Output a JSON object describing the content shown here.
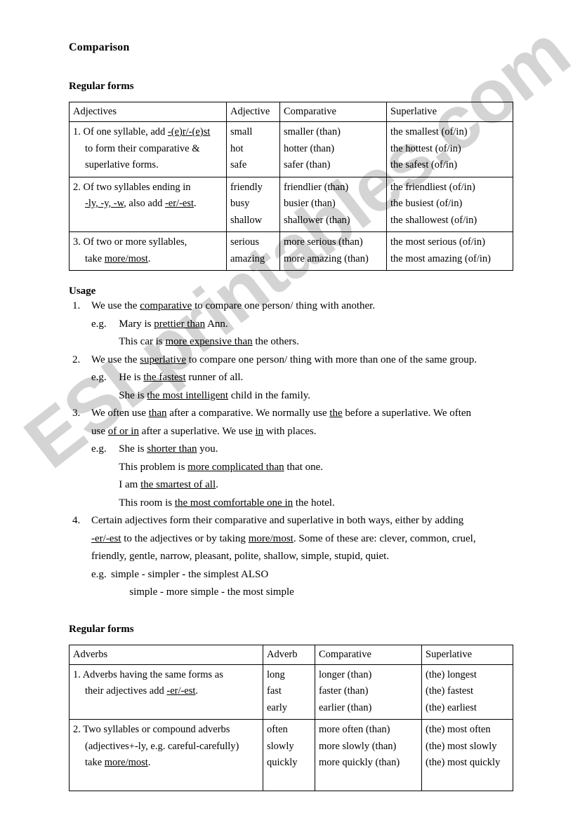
{
  "document": {
    "title": "Comparison",
    "watermark": "ESLprintables.com",
    "watermark_color": "#d4d4d4"
  },
  "adjectives_section": {
    "heading": "Regular forms",
    "table": {
      "headers": [
        "Adjectives",
        "Adjective",
        "Comparative",
        "Superlative"
      ],
      "rows": [
        {
          "rule": [
            "1. Of one syllable, add ",
            "-(e)r/-(e)st",
            " to form their comparative &",
            " superlative forms."
          ],
          "rule_lines": [
            {
              "text_before": "1. Of one syllable, add ",
              "underlined": "-(e)r/-(e)st",
              "text_after": "",
              "indent": false
            },
            {
              "text_before": "to form their comparative &",
              "underlined": "",
              "text_after": "",
              "indent": true
            },
            {
              "text_before": "superlative forms.",
              "underlined": "",
              "text_after": "",
              "indent": true
            }
          ],
          "adjective": [
            "small",
            "hot",
            "safe"
          ],
          "comparative": [
            "smaller (than)",
            "hotter (than)",
            "safer (than)"
          ],
          "superlative": [
            "the smallest (of/in)",
            "the hottest (of/in)",
            "the safest (of/in)"
          ]
        },
        {
          "rule_lines": [
            {
              "text_before": "2. Of two syllables ending in",
              "underlined": "",
              "text_after": "",
              "indent": false
            },
            {
              "text_before": "",
              "underlined": "-ly, -y, -w",
              "text_after": ", also add ",
              "underlined2": "-er/-est",
              "text_after2": ".",
              "indent": true
            }
          ],
          "adjective": [
            "friendly",
            "busy",
            "shallow"
          ],
          "comparative": [
            "friendlier (than)",
            "busier (than)",
            "shallower (than)"
          ],
          "superlative": [
            "the friendliest (of/in)",
            "the busiest (of/in)",
            "the shallowest (of/in)"
          ]
        },
        {
          "rule_lines": [
            {
              "text_before": "3. Of two or more syllables,",
              "underlined": "",
              "text_after": "",
              "indent": false
            },
            {
              "text_before": "take ",
              "underlined": "more/most",
              "text_after": ".",
              "indent": true
            }
          ],
          "adjective": [
            "serious",
            "amazing"
          ],
          "comparative": [
            "more serious (than)",
            "more amazing (than)"
          ],
          "superlative": [
            "the most serious (of/in)",
            "the most amazing (of/in)"
          ]
        }
      ]
    }
  },
  "usage_section": {
    "heading": "Usage",
    "items": [
      {
        "number": "1.",
        "lines": [
          {
            "parts": [
              {
                "t": "We use the ",
                "u": false
              },
              {
                "t": "comparative",
                "u": true
              },
              {
                "t": " to compare one person/ thing with another.",
                "u": false
              }
            ]
          }
        ],
        "examples": {
          "label": "e.g.",
          "lines": [
            {
              "parts": [
                {
                  "t": "Mary is ",
                  "u": false
                },
                {
                  "t": "prettier than",
                  "u": true
                },
                {
                  "t": " Ann.",
                  "u": false
                }
              ]
            },
            {
              "parts": [
                {
                  "t": "This car is ",
                  "u": false
                },
                {
                  "t": "more expensive than",
                  "u": true
                },
                {
                  "t": " the others.",
                  "u": false
                }
              ]
            }
          ]
        }
      },
      {
        "number": "2.",
        "lines": [
          {
            "parts": [
              {
                "t": "We use the ",
                "u": false
              },
              {
                "t": "superlative",
                "u": true
              },
              {
                "t": " to compare one person/ thing with more than one of the same group.",
                "u": false
              }
            ]
          }
        ],
        "examples": {
          "label": "e.g.",
          "lines": [
            {
              "parts": [
                {
                  "t": "He is ",
                  "u": false
                },
                {
                  "t": "the fastest",
                  "u": true
                },
                {
                  "t": " runner of all.",
                  "u": false
                }
              ]
            },
            {
              "parts": [
                {
                  "t": "She is ",
                  "u": false
                },
                {
                  "t": "the most intelligent",
                  "u": true
                },
                {
                  "t": " child in the family.",
                  "u": false
                }
              ]
            }
          ]
        }
      },
      {
        "number": "3.",
        "lines": [
          {
            "parts": [
              {
                "t": "We often use ",
                "u": false
              },
              {
                "t": "than",
                "u": true
              },
              {
                "t": " after a comparative. We normally use ",
                "u": false
              },
              {
                "t": "the",
                "u": true
              },
              {
                "t": " before a superlative. We often",
                "u": false
              }
            ]
          },
          {
            "parts": [
              {
                "t": "use ",
                "u": false
              },
              {
                "t": "of or in",
                "u": true
              },
              {
                "t": " after a superlative. We use ",
                "u": false
              },
              {
                "t": "in",
                "u": true
              },
              {
                "t": " with places.",
                "u": false
              }
            ]
          }
        ],
        "examples": {
          "label": "e.g.",
          "lines": [
            {
              "parts": [
                {
                  "t": "She is ",
                  "u": false
                },
                {
                  "t": "shorter than",
                  "u": true
                },
                {
                  "t": " you.",
                  "u": false
                }
              ]
            },
            {
              "parts": [
                {
                  "t": "This problem is ",
                  "u": false
                },
                {
                  "t": "more complicated than",
                  "u": true
                },
                {
                  "t": " that one.",
                  "u": false
                }
              ]
            },
            {
              "parts": [
                {
                  "t": "I am ",
                  "u": false
                },
                {
                  "t": "the smartest of all",
                  "u": true
                },
                {
                  "t": ".",
                  "u": false
                }
              ]
            },
            {
              "parts": [
                {
                  "t": "This room is ",
                  "u": false
                },
                {
                  "t": "the most comfortable one in",
                  "u": true
                },
                {
                  "t": " the hotel.",
                  "u": false
                }
              ]
            }
          ]
        }
      },
      {
        "number": "4.",
        "lines": [
          {
            "parts": [
              {
                "t": "Certain adjectives form their comparative and superlative in both ways, either by adding",
                "u": false
              }
            ]
          },
          {
            "parts": [
              {
                "t": "-er/-est",
                "u": true
              },
              {
                "t": " to the adjectives or by taking ",
                "u": false
              },
              {
                "t": "more/most",
                "u": true
              },
              {
                "t": ". Some of these are: clever, common, cruel,",
                "u": false
              }
            ]
          },
          {
            "parts": [
              {
                "t": "friendly, gentle, narrow, pleasant, polite, shallow, simple, stupid, quiet.",
                "u": false
              }
            ]
          }
        ],
        "examples": {
          "label": "e.g.",
          "lines": [
            {
              "parts": [
                {
                  "t": "simple -    simpler -     the simplest    ALSO",
                  "u": false
                }
              ]
            },
            {
              "parts": [
                {
                  "t": "simple - more simple - the most simple",
                  "u": false
                }
              ]
            }
          ]
        }
      }
    ]
  },
  "adverbs_section": {
    "heading": "Regular forms",
    "table": {
      "headers": [
        "Adverbs",
        "Adverb",
        "Comparative",
        "Superlative"
      ],
      "rows": [
        {
          "rule_lines": [
            {
              "text_before": "1. Adverbs having the same forms as",
              "underlined": "",
              "text_after": "",
              "indent": false
            },
            {
              "text_before": "their adjectives add ",
              "underlined": "-er/-est",
              "text_after": ".",
              "indent": true
            }
          ],
          "adverb": [
            "long",
            "fast",
            "early"
          ],
          "comparative": [
            "longer (than)",
            "faster (than)",
            "earlier (than)"
          ],
          "superlative": [
            "(the) longest",
            "(the) fastest",
            "(the) earliest"
          ]
        },
        {
          "rule_lines": [
            {
              "text_before": "2. Two syllables or compound adverbs",
              "underlined": "",
              "text_after": "",
              "indent": false
            },
            {
              "text_before": "(adjectives+-ly, e.g. careful-carefully)",
              "underlined": "",
              "text_after": "",
              "indent": true
            },
            {
              "text_before": "take ",
              "underlined": "more/most",
              "text_after": ".",
              "indent": true
            }
          ],
          "adverb": [
            "often",
            "slowly",
            "quickly"
          ],
          "comparative": [
            "more often (than)",
            "more slowly (than)",
            "more quickly (than)"
          ],
          "superlative": [
            "(the) most often",
            "(the) most slowly",
            "(the) most quickly"
          ]
        }
      ]
    }
  }
}
